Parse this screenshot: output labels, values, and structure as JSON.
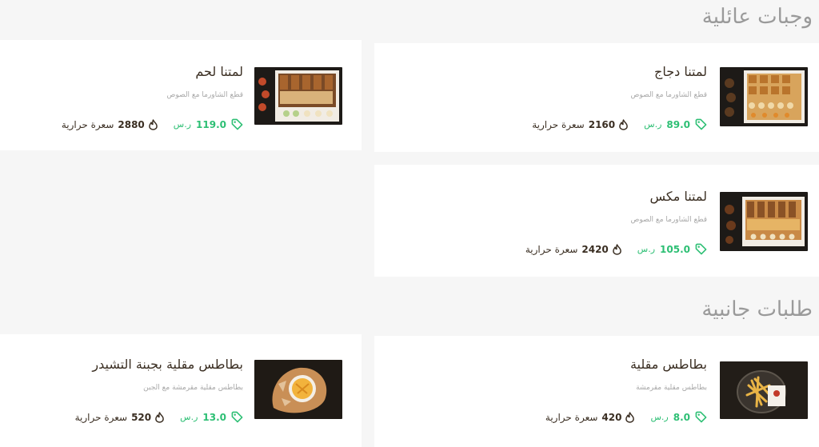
{
  "sections": [
    {
      "title": "وجبات عائلية"
    },
    {
      "title": "طلبات جانبية"
    }
  ],
  "currency": "ر.س",
  "calories_label": "سعرة حرارية",
  "items": [
    {
      "name": "لمتنا دجاج",
      "description": "قطع الشاورما مع الصوص",
      "price": "89.0",
      "calories": "2160"
    },
    {
      "name": "لمتنا لحم",
      "description": "قطع الشاورما مع الصوص",
      "price": "119.0",
      "calories": "2880"
    },
    {
      "name": "لمتنا مكس",
      "description": "قطع الشاورما مع الصوص",
      "price": "105.0",
      "calories": "2420"
    },
    {
      "name": "بطاطس مقلية",
      "description": "بطاطس مقلية مقرمشة",
      "price": "8.0",
      "calories": "420"
    },
    {
      "name": "بطاطس مقلية بجبنة التشيدر",
      "description": "بطاطس مقلية مقرمشة مع الجبن",
      "price": "13.0",
      "calories": "520"
    }
  ],
  "colors": {
    "price": "#2dbf74",
    "text": "#3a2e22",
    "muted": "#a8a8a8",
    "section": "#9a9a9a",
    "card": "#ffffff",
    "background": "#f6f6f6"
  },
  "icons": {
    "price": "price-tag-icon",
    "calories": "flame-icon"
  }
}
